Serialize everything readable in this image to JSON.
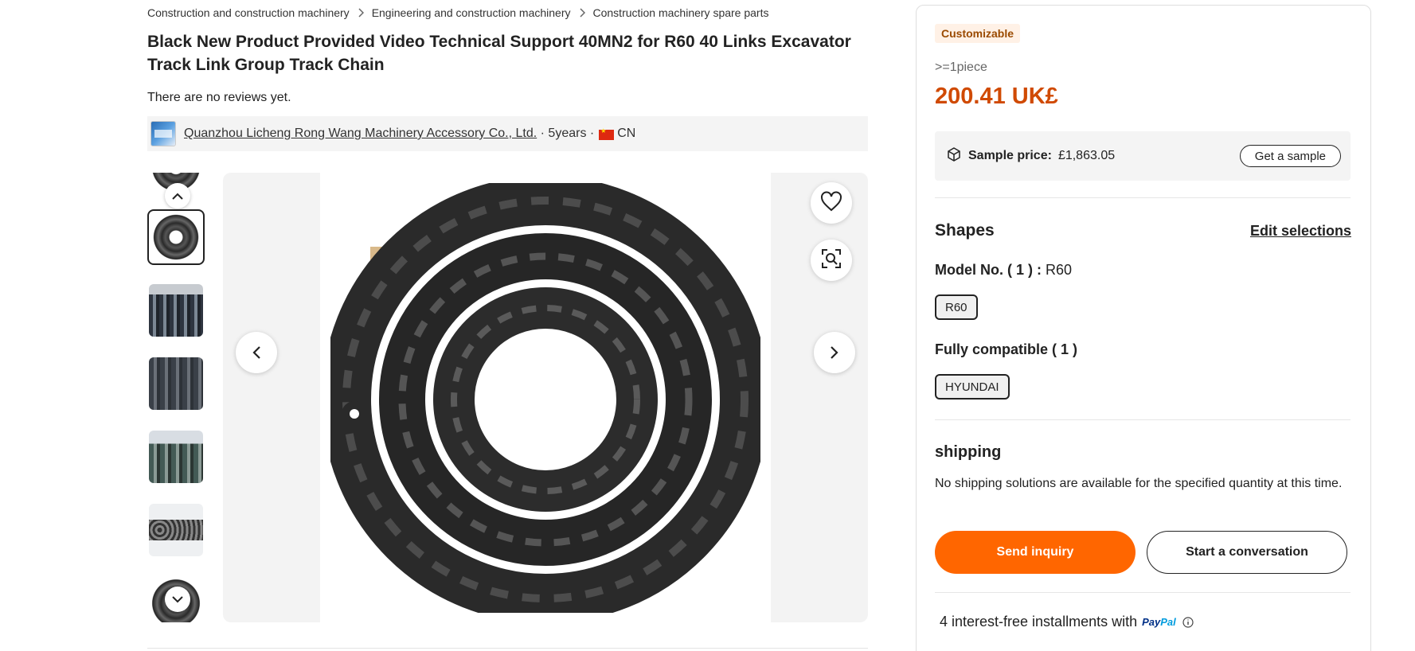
{
  "breadcrumb": {
    "items": [
      "Construction and construction machinery",
      "Engineering and construction machinery",
      "Construction machinery spare parts"
    ]
  },
  "product": {
    "title": "Black New Product Provided Video Technical Support 40MN2 for R60 40 Links Excavator Track Link Group Track Chain",
    "reviews": "There are no reviews yet."
  },
  "supplier": {
    "name": "Quanzhou Licheng Rong Wang Machinery Accessory Co., Ltd.",
    "years": "· 5years ·",
    "country": "CN"
  },
  "gallery": {
    "thumb_count": 7,
    "active_index": 1
  },
  "panel": {
    "tag": "Customizable",
    "moq": ">=1piece",
    "price": "200.41 UK£",
    "sample_label": "Sample price:",
    "sample_price": "£1,863.05",
    "sample_button": "Get a sample",
    "shapes_heading": "Shapes",
    "edit_selections": "Edit selections",
    "model_label": "Model No. ( 1 ) :",
    "model_value": "R60",
    "model_chip": "R60",
    "compatible_label": "Fully compatible ( 1 )",
    "compatible_chip": "HYUNDAI",
    "shipping_heading": "shipping",
    "shipping_text": "No shipping solutions are available for the specified quantity at this time.",
    "send_inquiry": "Send inquiry",
    "start_conversation": "Start a conversation",
    "installments": "4 interest-free installments with",
    "paypal_a": "Pay",
    "paypal_b": "Pal"
  },
  "colors": {
    "price": "#d04a02",
    "primary_button": "#ff6600",
    "tag_bg": "#fff1e6"
  },
  "icons": {
    "breadcrumb_separator": "chevron-right-icon",
    "sample": "box-icon",
    "favorite": "heart-icon",
    "image_search": "image-search-icon",
    "info": "info-icon"
  }
}
